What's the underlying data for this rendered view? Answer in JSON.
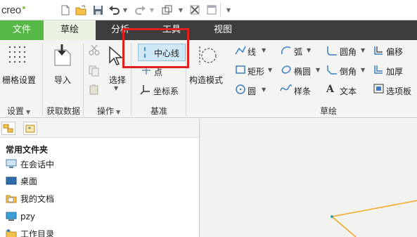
{
  "app": {
    "logo_text": "creo"
  },
  "tabs": {
    "file": "文件",
    "sketch": "草绘",
    "analysis": "分析",
    "tools": "工具",
    "view": "视图"
  },
  "ribbon": {
    "setup": {
      "grid_settings": "栅格设置",
      "group_label": "设置"
    },
    "get_data": {
      "import": "导入",
      "group_label": "获取数据"
    },
    "operations": {
      "select": "选择",
      "group_label": "操作"
    },
    "datum": {
      "centerline": "中心线",
      "point": "点",
      "coordinate_system": "坐标系",
      "group_label": "基准"
    },
    "sketch": {
      "construction_mode": "构造模式",
      "line": "线",
      "arc": "弧",
      "fillet": "圆角",
      "offset": "偏移",
      "rectangle": "矩形",
      "ellipse": "椭圆",
      "chamfer": "倒角",
      "thicken": "加厚",
      "circle": "圆",
      "spline": "样条",
      "text": "文本",
      "palette": "选项板",
      "group_label": "草绘"
    }
  },
  "navigator": {
    "favorites_header": "常用文件夹",
    "items": [
      {
        "label": "在会话中",
        "icon": "monitor-icon"
      },
      {
        "label": "桌面",
        "icon": "desktop-icon"
      },
      {
        "label": "我的文档",
        "icon": "documents-folder-icon"
      },
      {
        "label": "pzy",
        "icon": "computer-icon"
      },
      {
        "label": "工作目录",
        "icon": "working-folder-icon"
      }
    ]
  },
  "colors": {
    "file_tab": "#58b847",
    "tab_bar": "#3c3c3c",
    "active_tab": "#eaf3e2",
    "highlight": "#e0201c",
    "selected_button": "#cfe8f6",
    "sketch_line": "#f5a623"
  }
}
